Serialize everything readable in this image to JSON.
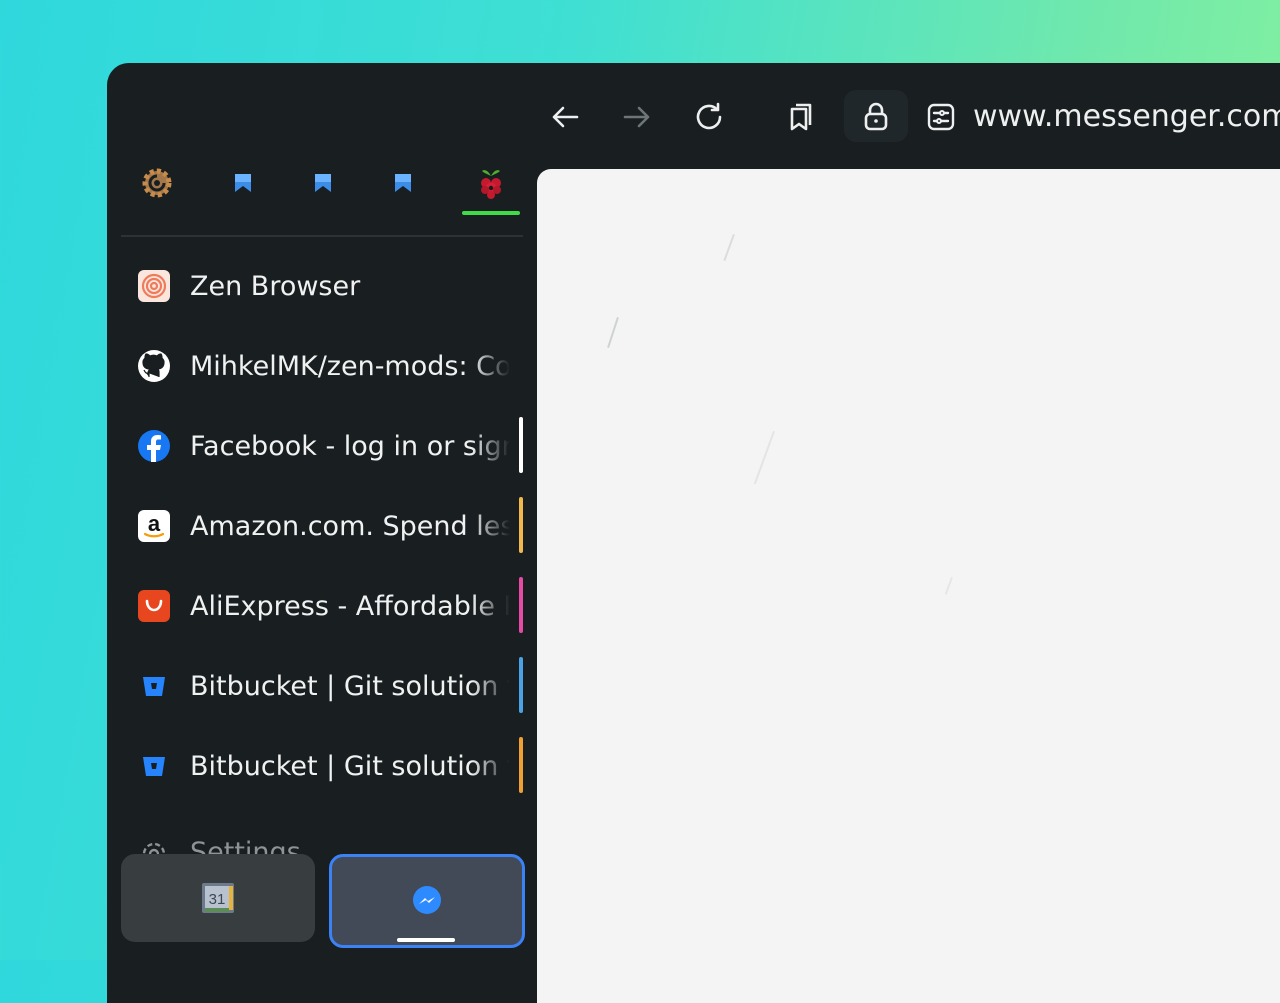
{
  "toolbar": {
    "back": "back-arrow",
    "forward": "forward-arrow",
    "reload": "reload",
    "url_host": "www.messenger.com",
    "url_rest": "/"
  },
  "essentials": [
    {
      "name": "grafana",
      "icon": "grafana-icon"
    },
    {
      "name": "bookmark-1",
      "icon": "blue-bookmark-icon"
    },
    {
      "name": "bookmark-2",
      "icon": "blue-bookmark-icon"
    },
    {
      "name": "bookmark-3",
      "icon": "blue-bookmark-icon"
    },
    {
      "name": "raspberry-pi",
      "icon": "raspberry-icon",
      "active": true
    }
  ],
  "tabs": [
    {
      "title": "Zen Browser",
      "icon": "zen-icon",
      "marker": ""
    },
    {
      "title": "MihkelMK/zen-mods: Co",
      "icon": "github-icon",
      "marker": ""
    },
    {
      "title": "Facebook - log in or sign",
      "icon": "facebook-icon",
      "marker": "#ffffff"
    },
    {
      "title": "Amazon.com. Spend less",
      "icon": "amazon-icon",
      "marker": "#f2b84b"
    },
    {
      "title": "AliExpress - Affordable P",
      "icon": "aliexpress-icon",
      "marker": "#e64aa6"
    },
    {
      "title": "Bitbucket | Git solution f",
      "icon": "bitbucket-icon",
      "marker": "#4aa3e6"
    },
    {
      "title": "Bitbucket | Git solution f",
      "icon": "bitbucket-icon",
      "marker": "#f0a030"
    }
  ],
  "settings_label": "Settings",
  "pinned": [
    {
      "name": "google-calendar",
      "icon": "calendar-icon",
      "label": "31"
    },
    {
      "name": "messenger",
      "icon": "messenger-icon",
      "active": true
    }
  ],
  "colors": {
    "accent_green": "#3fdc4a",
    "accent_blue": "#3b82f6",
    "window_bg": "#191e20"
  }
}
